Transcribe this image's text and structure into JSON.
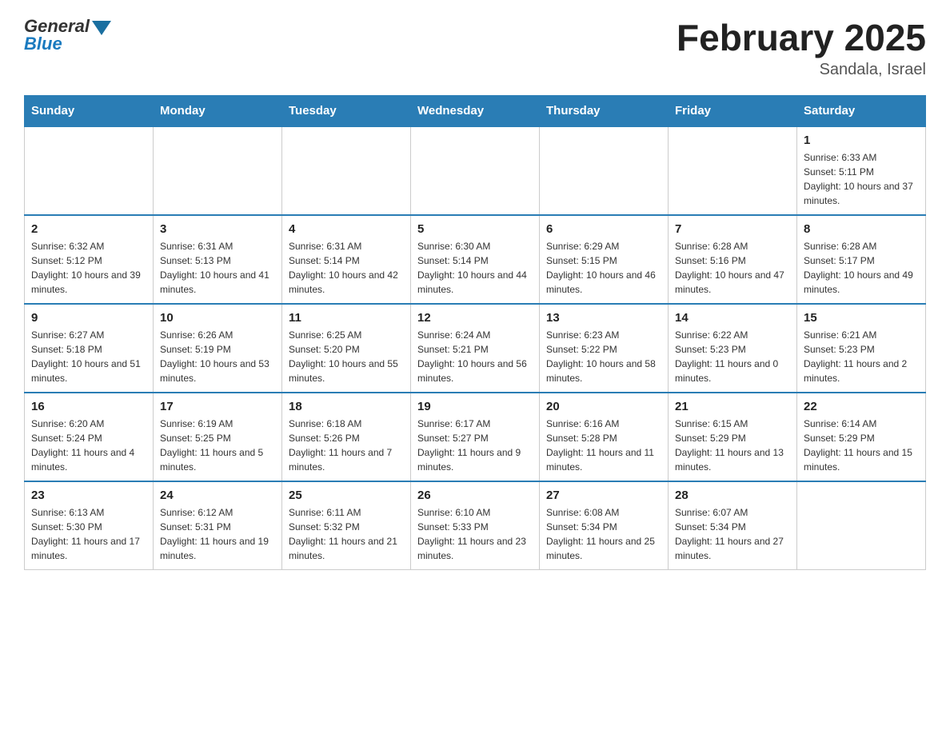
{
  "logo": {
    "general": "General",
    "blue": "Blue"
  },
  "header": {
    "month_year": "February 2025",
    "location": "Sandala, Israel"
  },
  "days_of_week": [
    "Sunday",
    "Monday",
    "Tuesday",
    "Wednesday",
    "Thursday",
    "Friday",
    "Saturday"
  ],
  "weeks": [
    [
      null,
      null,
      null,
      null,
      null,
      null,
      {
        "day": "1",
        "sunrise": "Sunrise: 6:33 AM",
        "sunset": "Sunset: 5:11 PM",
        "daylight": "Daylight: 10 hours and 37 minutes."
      }
    ],
    [
      {
        "day": "2",
        "sunrise": "Sunrise: 6:32 AM",
        "sunset": "Sunset: 5:12 PM",
        "daylight": "Daylight: 10 hours and 39 minutes."
      },
      {
        "day": "3",
        "sunrise": "Sunrise: 6:31 AM",
        "sunset": "Sunset: 5:13 PM",
        "daylight": "Daylight: 10 hours and 41 minutes."
      },
      {
        "day": "4",
        "sunrise": "Sunrise: 6:31 AM",
        "sunset": "Sunset: 5:14 PM",
        "daylight": "Daylight: 10 hours and 42 minutes."
      },
      {
        "day": "5",
        "sunrise": "Sunrise: 6:30 AM",
        "sunset": "Sunset: 5:14 PM",
        "daylight": "Daylight: 10 hours and 44 minutes."
      },
      {
        "day": "6",
        "sunrise": "Sunrise: 6:29 AM",
        "sunset": "Sunset: 5:15 PM",
        "daylight": "Daylight: 10 hours and 46 minutes."
      },
      {
        "day": "7",
        "sunrise": "Sunrise: 6:28 AM",
        "sunset": "Sunset: 5:16 PM",
        "daylight": "Daylight: 10 hours and 47 minutes."
      },
      {
        "day": "8",
        "sunrise": "Sunrise: 6:28 AM",
        "sunset": "Sunset: 5:17 PM",
        "daylight": "Daylight: 10 hours and 49 minutes."
      }
    ],
    [
      {
        "day": "9",
        "sunrise": "Sunrise: 6:27 AM",
        "sunset": "Sunset: 5:18 PM",
        "daylight": "Daylight: 10 hours and 51 minutes."
      },
      {
        "day": "10",
        "sunrise": "Sunrise: 6:26 AM",
        "sunset": "Sunset: 5:19 PM",
        "daylight": "Daylight: 10 hours and 53 minutes."
      },
      {
        "day": "11",
        "sunrise": "Sunrise: 6:25 AM",
        "sunset": "Sunset: 5:20 PM",
        "daylight": "Daylight: 10 hours and 55 minutes."
      },
      {
        "day": "12",
        "sunrise": "Sunrise: 6:24 AM",
        "sunset": "Sunset: 5:21 PM",
        "daylight": "Daylight: 10 hours and 56 minutes."
      },
      {
        "day": "13",
        "sunrise": "Sunrise: 6:23 AM",
        "sunset": "Sunset: 5:22 PM",
        "daylight": "Daylight: 10 hours and 58 minutes."
      },
      {
        "day": "14",
        "sunrise": "Sunrise: 6:22 AM",
        "sunset": "Sunset: 5:23 PM",
        "daylight": "Daylight: 11 hours and 0 minutes."
      },
      {
        "day": "15",
        "sunrise": "Sunrise: 6:21 AM",
        "sunset": "Sunset: 5:23 PM",
        "daylight": "Daylight: 11 hours and 2 minutes."
      }
    ],
    [
      {
        "day": "16",
        "sunrise": "Sunrise: 6:20 AM",
        "sunset": "Sunset: 5:24 PM",
        "daylight": "Daylight: 11 hours and 4 minutes."
      },
      {
        "day": "17",
        "sunrise": "Sunrise: 6:19 AM",
        "sunset": "Sunset: 5:25 PM",
        "daylight": "Daylight: 11 hours and 5 minutes."
      },
      {
        "day": "18",
        "sunrise": "Sunrise: 6:18 AM",
        "sunset": "Sunset: 5:26 PM",
        "daylight": "Daylight: 11 hours and 7 minutes."
      },
      {
        "day": "19",
        "sunrise": "Sunrise: 6:17 AM",
        "sunset": "Sunset: 5:27 PM",
        "daylight": "Daylight: 11 hours and 9 minutes."
      },
      {
        "day": "20",
        "sunrise": "Sunrise: 6:16 AM",
        "sunset": "Sunset: 5:28 PM",
        "daylight": "Daylight: 11 hours and 11 minutes."
      },
      {
        "day": "21",
        "sunrise": "Sunrise: 6:15 AM",
        "sunset": "Sunset: 5:29 PM",
        "daylight": "Daylight: 11 hours and 13 minutes."
      },
      {
        "day": "22",
        "sunrise": "Sunrise: 6:14 AM",
        "sunset": "Sunset: 5:29 PM",
        "daylight": "Daylight: 11 hours and 15 minutes."
      }
    ],
    [
      {
        "day": "23",
        "sunrise": "Sunrise: 6:13 AM",
        "sunset": "Sunset: 5:30 PM",
        "daylight": "Daylight: 11 hours and 17 minutes."
      },
      {
        "day": "24",
        "sunrise": "Sunrise: 6:12 AM",
        "sunset": "Sunset: 5:31 PM",
        "daylight": "Daylight: 11 hours and 19 minutes."
      },
      {
        "day": "25",
        "sunrise": "Sunrise: 6:11 AM",
        "sunset": "Sunset: 5:32 PM",
        "daylight": "Daylight: 11 hours and 21 minutes."
      },
      {
        "day": "26",
        "sunrise": "Sunrise: 6:10 AM",
        "sunset": "Sunset: 5:33 PM",
        "daylight": "Daylight: 11 hours and 23 minutes."
      },
      {
        "day": "27",
        "sunrise": "Sunrise: 6:08 AM",
        "sunset": "Sunset: 5:34 PM",
        "daylight": "Daylight: 11 hours and 25 minutes."
      },
      {
        "day": "28",
        "sunrise": "Sunrise: 6:07 AM",
        "sunset": "Sunset: 5:34 PM",
        "daylight": "Daylight: 11 hours and 27 minutes."
      },
      null
    ]
  ]
}
